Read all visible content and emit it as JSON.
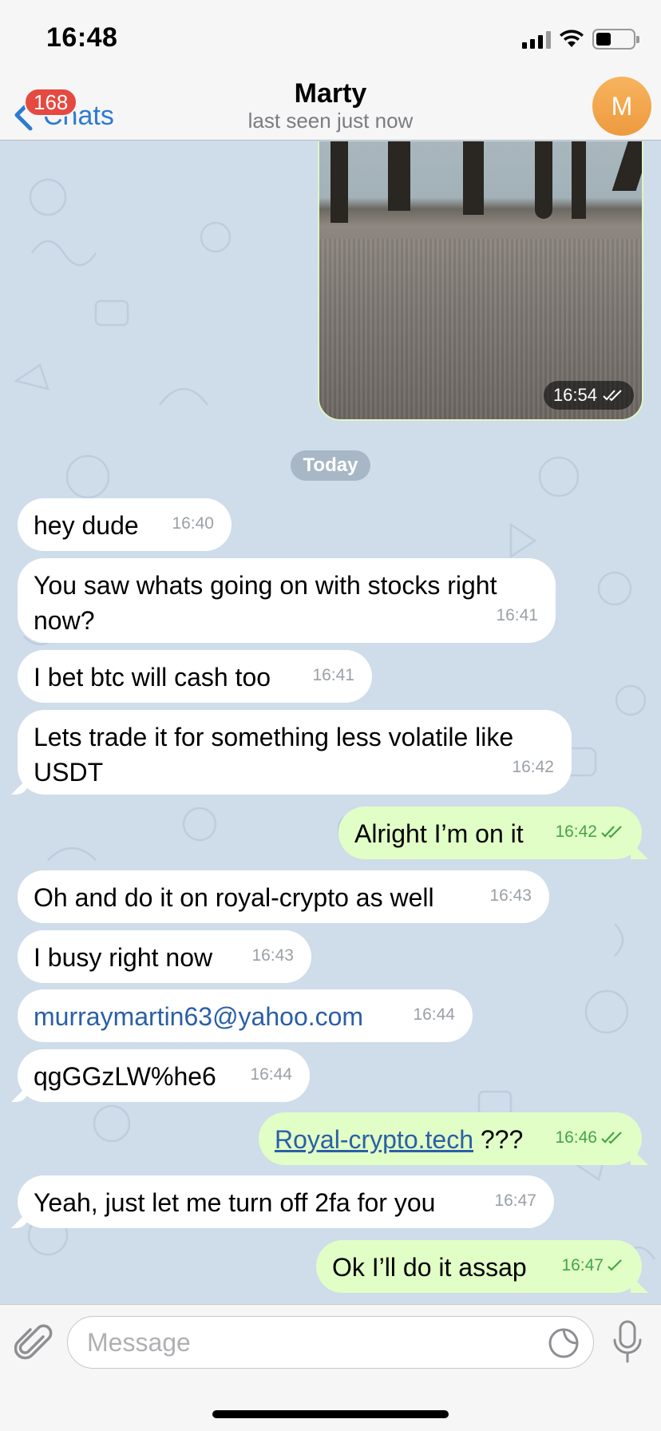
{
  "status_bar": {
    "time": "16:48"
  },
  "nav": {
    "back_label": "Chats",
    "unread_count": "168",
    "title": "Marty",
    "subtitle": "last seen just now",
    "avatar_initial": "M"
  },
  "photo_message": {
    "time": "16:54"
  },
  "date_separator": "Today",
  "messages": [
    {
      "dir": "in",
      "text": "hey dude",
      "time": "16:40"
    },
    {
      "dir": "in",
      "text": "You saw whats going on with stocks right now?",
      "time": "16:41"
    },
    {
      "dir": "in",
      "text": "I bet btc will cash too",
      "time": "16:41"
    },
    {
      "dir": "in",
      "text": "Lets trade it for something less volatile like USDT",
      "time": "16:42"
    },
    {
      "dir": "out",
      "text": "Alright I’m on it",
      "time": "16:42",
      "status": "read"
    },
    {
      "dir": "in",
      "text": "Oh and do it on royal-crypto as well",
      "time": "16:43"
    },
    {
      "dir": "in",
      "text": "I busy right now",
      "time": "16:43"
    },
    {
      "dir": "in",
      "text": "murraymartin63@yahoo.com",
      "time": "16:44"
    },
    {
      "dir": "in",
      "text": "qgGGzLW%he6",
      "time": "16:44"
    },
    {
      "dir": "out",
      "link": "Royal-crypto.tech",
      "text": " ???",
      "time": "16:46",
      "status": "read"
    },
    {
      "dir": "in",
      "text": "Yeah, just let me turn off 2fa for you",
      "time": "16:47"
    },
    {
      "dir": "out",
      "text": "Ok I’ll do it assap",
      "time": "16:47",
      "status": "sent"
    }
  ],
  "input": {
    "placeholder": "Message"
  },
  "colors": {
    "accent": "#2e7ad1",
    "badge": "#e5493f",
    "outgoing_bubble": "#e1fec6",
    "incoming_bubble": "#ffffff",
    "chat_background": "#cfdcea",
    "read_check": "#43a547"
  },
  "icons": {
    "back": "chevron-left-icon",
    "attach": "paperclip-icon",
    "sticker": "sticker-icon",
    "mic": "microphone-icon",
    "read": "double-check-icon",
    "sent": "single-check-icon"
  }
}
